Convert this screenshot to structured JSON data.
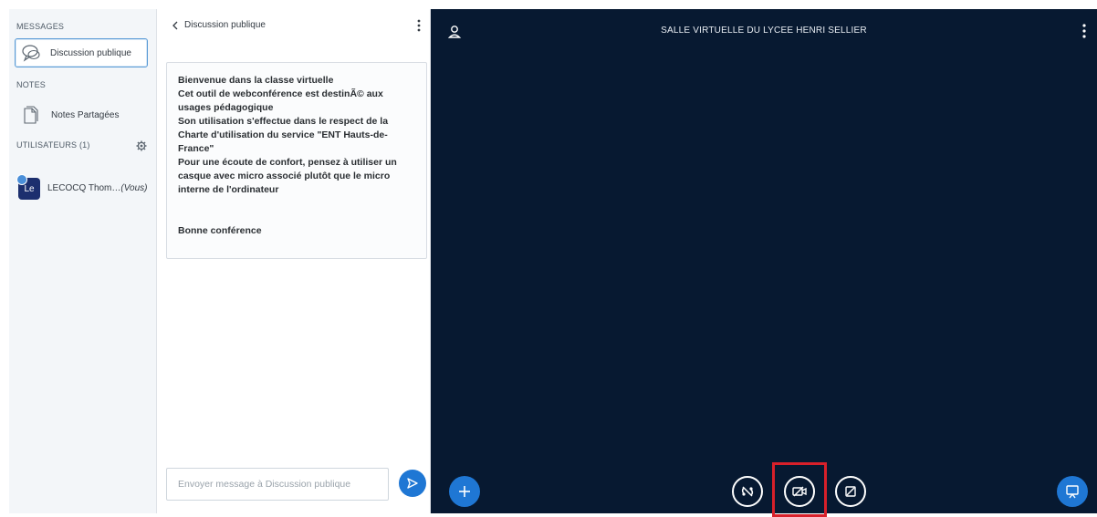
{
  "sidebar": {
    "messages_heading": "MESSAGES",
    "public_chat_label": "Discussion publique",
    "notes_heading": "NOTES",
    "shared_notes_label": "Notes Partagées",
    "users_heading": "UTILISATEURS (1)",
    "user": {
      "initials": "Le",
      "name": "LECOCQ Thom…",
      "suffix": "(Vous)"
    }
  },
  "chat": {
    "header_title": "Discussion publique",
    "welcome_lines": [
      "Bienvenue dans la classe virtuelle",
      "Cet outil de webconférence est destinÃ© aux usages pédagogique",
      "Son utilisation s'effectue dans le respect de la Charte d'utilisation du service \"ENT Hauts-de-France\"",
      "Pour une écoute de confort, pensez à utiliser un casque avec micro associé plutôt que le micro interne de l'ordinateur"
    ],
    "welcome_closing": "Bonne conférence",
    "input_placeholder": "Envoyer message à Discussion publique"
  },
  "stage": {
    "title": "SALLE VIRTUELLE DU LYCEE HENRI SELLIER"
  },
  "icons": {
    "chat": "chat-bubble-icon",
    "notes": "document-icon",
    "settings": "gear-icon",
    "back": "chevron-left-icon",
    "menu": "kebab-menu-icon",
    "send": "send-icon",
    "user": "user-icon",
    "actions": "plus-icon",
    "audio": "audio-off-icon",
    "camera": "camera-off-icon",
    "screen": "screen-share-off-icon",
    "presentation": "presentation-icon"
  },
  "colors": {
    "accent": "#1f77d4",
    "stage_bg": "#071931",
    "highlight": "#d8202a",
    "avatar_bg": "#1c2f6e"
  }
}
